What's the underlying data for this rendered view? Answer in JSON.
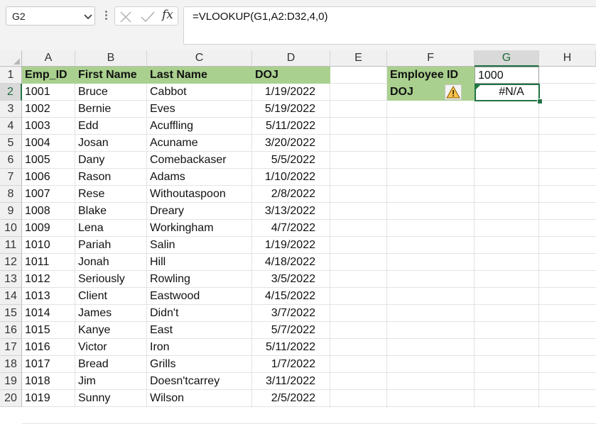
{
  "name_box": {
    "value": "G2"
  },
  "formula_bar": {
    "formula": "=VLOOKUP(G1,A2:D32,4,0)",
    "fx_label": "fx"
  },
  "columns": [
    "A",
    "B",
    "C",
    "D",
    "E",
    "F",
    "G",
    "H"
  ],
  "active_cell": "G2",
  "table": {
    "headers": [
      "Emp_ID",
      "First Name",
      "Last Name",
      "DOJ"
    ],
    "rows": [
      [
        "1001",
        "Bruce",
        "Cabbot",
        "1/19/2022"
      ],
      [
        "1002",
        "Bernie",
        "Eves",
        "5/19/2022"
      ],
      [
        "1003",
        "Edd",
        "Acuffling",
        "5/11/2022"
      ],
      [
        "1004",
        "Josan",
        "Acuname",
        "3/20/2022"
      ],
      [
        "1005",
        "Dany",
        "Comebackaser",
        "5/5/2022"
      ],
      [
        "1006",
        "Rason",
        "Adams",
        "1/10/2022"
      ],
      [
        "1007",
        "Rese",
        "Withoutaspoon",
        "2/8/2022"
      ],
      [
        "1008",
        "Blake",
        "Dreary",
        "3/13/2022"
      ],
      [
        "1009",
        "Lena",
        "Workingham",
        "4/7/2022"
      ],
      [
        "1010",
        "Pariah",
        "Salin",
        "1/19/2022"
      ],
      [
        "1011",
        "Jonah",
        "Hill",
        "4/18/2022"
      ],
      [
        "1012",
        "Seriously",
        "Rowling",
        "3/5/2022"
      ],
      [
        "1013",
        "Client",
        "Eastwood",
        "4/15/2022"
      ],
      [
        "1014",
        "James",
        "Didn't",
        "3/7/2022"
      ],
      [
        "1015",
        "Kanye",
        "East",
        "5/7/2022"
      ],
      [
        "1016",
        "Victor",
        "Iron",
        "5/11/2022"
      ],
      [
        "1017",
        "Bread",
        "Grills",
        "1/7/2022"
      ],
      [
        "1018",
        "Jim",
        "Doesn'tcarrey",
        "3/11/2022"
      ],
      [
        "1019",
        "Sunny",
        "Wilson",
        "2/5/2022"
      ]
    ]
  },
  "lookup": {
    "employee_id_label": "Employee ID",
    "employee_id_value": "1000",
    "doj_label": "DOJ",
    "doj_value": "#N/A"
  },
  "row_numbers": [
    "1",
    "2",
    "3",
    "4",
    "5",
    "6",
    "7",
    "8",
    "9",
    "10",
    "11",
    "12",
    "13",
    "14",
    "15",
    "16",
    "17",
    "18",
    "19",
    "20"
  ],
  "colors": {
    "header_fill": "#a9d08e",
    "selection": "#217346"
  },
  "icons": {
    "warning": "warning-icon",
    "cancel": "cancel-icon",
    "enter": "enter-icon",
    "dropdown": "chevron-down-icon"
  }
}
